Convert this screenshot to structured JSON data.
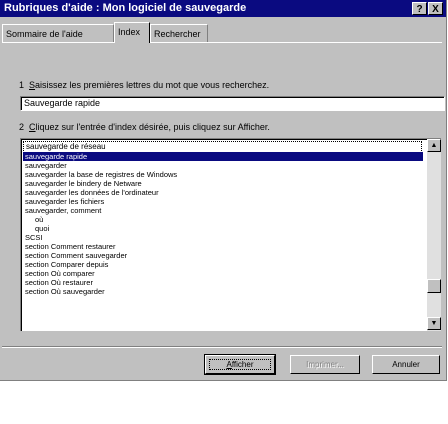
{
  "window": {
    "title": "Rubriques d'aide : Mon logiciel de sauvegarde",
    "help_button": "?",
    "close_button": "X"
  },
  "tabs": [
    {
      "label": "Sommaire de l'aide"
    },
    {
      "label": "Index"
    },
    {
      "label": "Rechercher"
    }
  ],
  "step1": {
    "number": "1",
    "first_letter": "S",
    "text": "aisissez les premières lettres du mot que vous recherchez."
  },
  "search": {
    "value": "Sauvegarde rapide"
  },
  "step2": {
    "number": "2",
    "first_letter": "C",
    "text": "liquez sur l'entrée d'index désirée, puis cliquez sur Afficher."
  },
  "list": {
    "top_item": "sauvegarde de réseau",
    "items": [
      {
        "label": "sauvegarde rapide",
        "selected": true,
        "indent": false
      },
      {
        "label": "sauvegarder",
        "selected": false,
        "indent": false
      },
      {
        "label": "sauvegarder la base de registres de Windows",
        "selected": false,
        "indent": false
      },
      {
        "label": "sauvegarder le bindery de Netware",
        "selected": false,
        "indent": false
      },
      {
        "label": "sauvegarder les données de l'ordinateur",
        "selected": false,
        "indent": false
      },
      {
        "label": "sauvegarder les fichiers",
        "selected": false,
        "indent": false
      },
      {
        "label": "sauvegarder, comment",
        "selected": false,
        "indent": false
      },
      {
        "label": "où",
        "selected": false,
        "indent": true
      },
      {
        "label": "quoi",
        "selected": false,
        "indent": true
      },
      {
        "label": "SCSI",
        "selected": false,
        "indent": false
      },
      {
        "label": "section Comment restaurer",
        "selected": false,
        "indent": false
      },
      {
        "label": "section Comment sauvegarder",
        "selected": false,
        "indent": false
      },
      {
        "label": "section Comparer depuis",
        "selected": false,
        "indent": false
      },
      {
        "label": "section Où comparer",
        "selected": false,
        "indent": false
      },
      {
        "label": "section Où restaurer",
        "selected": false,
        "indent": false
      },
      {
        "label": "section Où sauvegarder",
        "selected": false,
        "indent": false
      }
    ]
  },
  "buttons": {
    "display_first": "A",
    "display_rest": "fficher",
    "print": "Imprimer...",
    "cancel": "Annuler"
  },
  "colors": {
    "titlebar": "#0a0a80",
    "selection": "#0a0a80",
    "face": "#c0c0c0"
  }
}
